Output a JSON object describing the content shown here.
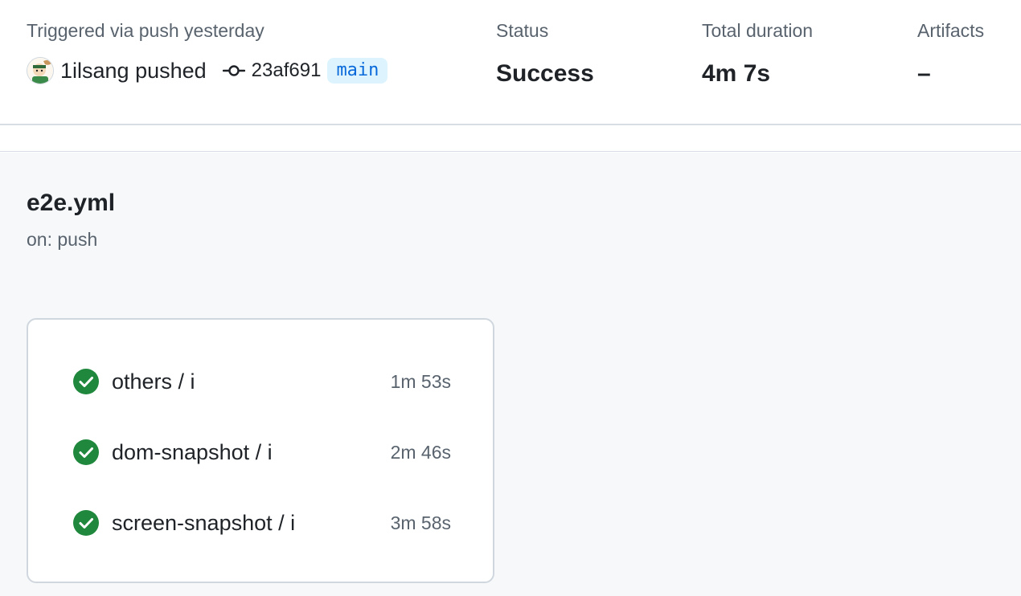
{
  "summary": {
    "trigger_label": "Triggered via push yesterday",
    "actor": "1ilsang",
    "action": "pushed",
    "commit_sha": "23af691",
    "branch": "main",
    "status_label": "Status",
    "status_value": "Success",
    "duration_label": "Total duration",
    "duration_value": "4m 7s",
    "artifacts_label": "Artifacts",
    "artifacts_value": "–"
  },
  "workflow": {
    "file_name": "e2e.yml",
    "trigger": "on: push",
    "jobs": [
      {
        "name": "others / i",
        "duration": "1m 53s",
        "status": "success"
      },
      {
        "name": "dom-snapshot / i",
        "duration": "2m 46s",
        "status": "success"
      },
      {
        "name": "screen-snapshot / i",
        "duration": "3m 58s",
        "status": "success"
      }
    ]
  },
  "icons": {
    "avatar": "user-avatar",
    "commit": "git-commit-icon",
    "job_status": "check-circle-fill-icon"
  },
  "colors": {
    "success": "#1f883d",
    "branch_text": "#0969da",
    "branch_bg": "#ddf4ff",
    "muted_text": "#59636e",
    "workflow_bg": "#f6f8fa"
  }
}
